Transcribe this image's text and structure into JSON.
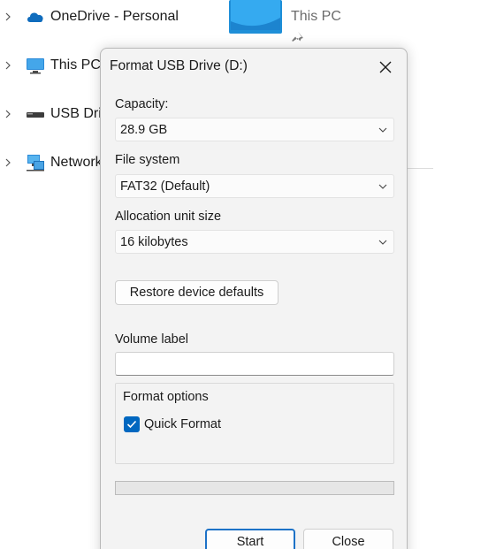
{
  "explorer": {
    "nav_items": [
      {
        "label": "OneDrive - Personal",
        "icon": "onedrive-cloud-icon"
      },
      {
        "label": "This PC",
        "icon": "monitor-icon"
      },
      {
        "label": "USB Drive",
        "icon": "usb-drive-icon"
      },
      {
        "label": "Network",
        "icon": "network-icon"
      }
    ],
    "quick_access_tile": {
      "label": "This PC",
      "icon": "pin-icon"
    }
  },
  "dialog": {
    "title": "Format USB Drive (D:)",
    "capacity": {
      "label": "Capacity:",
      "value": "28.9 GB"
    },
    "file_system": {
      "label": "File system",
      "value": "FAT32 (Default)"
    },
    "allocation_unit": {
      "label": "Allocation unit size",
      "value": "16 kilobytes"
    },
    "restore_label": "Restore device defaults",
    "volume_label": {
      "label": "Volume label",
      "value": ""
    },
    "format_options": {
      "title": "Format options",
      "quick_format_label": "Quick Format",
      "quick_format_checked": true
    },
    "progress": 0,
    "start_label": "Start",
    "close_label": "Close"
  },
  "colors": {
    "accent": "#0067c0",
    "dialog_bg": "#f3f3f3",
    "onedrive": "#0f6cbd"
  }
}
